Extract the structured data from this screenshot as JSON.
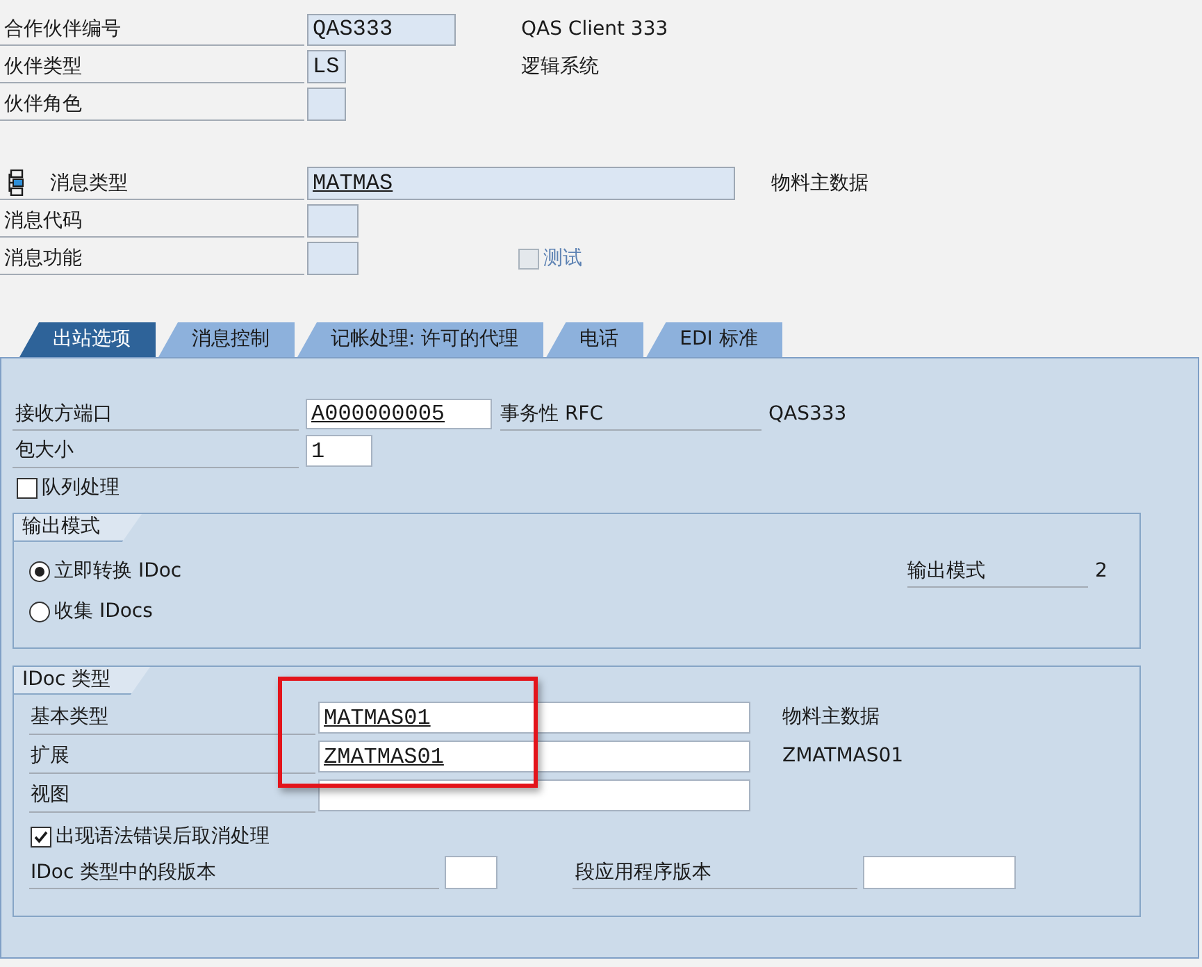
{
  "partner": {
    "number": {
      "label": "合作伙伴编号",
      "value": "QAS333",
      "read_only": true,
      "underlined": false,
      "description": "QAS Client 333"
    },
    "type": {
      "label": "伙伴类型",
      "value": "LS",
      "read_only": true,
      "underlined": false,
      "description": "逻辑系统"
    },
    "role": {
      "label": "伙伴角色",
      "read_only": true
    }
  },
  "message": {
    "type": {
      "label": "消息类型",
      "value": "MATMAS",
      "read_only": true,
      "underlined": true,
      "description": "物料主数据"
    },
    "code": {
      "label": "消息代码",
      "read_only": true
    },
    "function": {
      "label": "消息功能",
      "read_only": true
    },
    "test": {
      "label": "测试",
      "checked": false,
      "disabled": true
    }
  },
  "tabs": [
    {
      "label": "出站选项",
      "selected": true
    },
    {
      "label": "消息控制",
      "selected": false
    },
    {
      "label": "记帐处理: 许可的代理",
      "selected": false
    },
    {
      "label": "电话",
      "selected": false
    },
    {
      "label": "EDI 标准",
      "selected": false
    }
  ],
  "outbound": {
    "receiver_port": {
      "label": "接收方端口",
      "value": "A000000005",
      "read_only": false,
      "underlined": true
    },
    "port_type": {
      "label": "事务性 RFC",
      "value": "QAS333"
    },
    "pack_size": {
      "label": "包大小",
      "value": "1",
      "read_only": false,
      "underlined": false
    },
    "queue_processing": {
      "label": "队列处理",
      "checked": false,
      "disabled": false
    },
    "output_mode": {
      "title": "输出模式",
      "options": [
        {
          "label": "立即转换 IDoc",
          "selected": true
        },
        {
          "label": "收集 IDocs",
          "selected": false
        }
      ],
      "mode": {
        "label": "输出模式",
        "value": "2"
      }
    },
    "idoc_type": {
      "title": "IDoc 类型",
      "highlighted": true,
      "basic_type": {
        "label": "基本类型",
        "value": "MATMAS01",
        "read_only": false,
        "underlined": true,
        "description": "物料主数据"
      },
      "extension": {
        "label": "扩展",
        "value": "ZMATMAS01",
        "read_only": false,
        "underlined": true,
        "description": "ZMATMAS01"
      },
      "view": {
        "label": "视图",
        "read_only": false
      },
      "cancel_on_syntax_error": {
        "label": "出现语法错误后取消处理",
        "checked": true,
        "disabled": false
      },
      "segment_release": {
        "label": "IDoc 类型中的段版本",
        "read_only": false
      },
      "segment_app_release": {
        "label": "段应用程序版本",
        "read_only": false
      }
    }
  }
}
